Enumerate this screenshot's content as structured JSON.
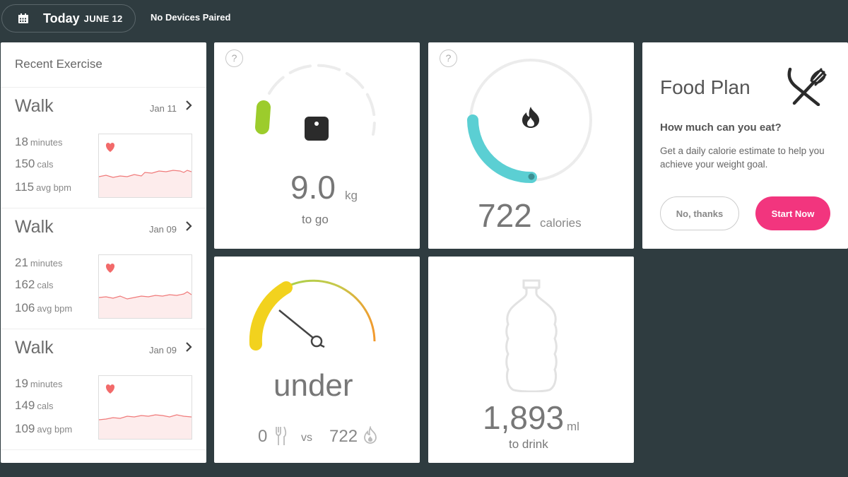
{
  "header": {
    "today": "Today",
    "date": "JUNE 12",
    "devices": "No Devices Paired"
  },
  "exercise": {
    "title": "Recent Exercise",
    "items": [
      {
        "name": "Walk",
        "date": "Jan 11",
        "minutes": "18",
        "minutes_unit": "minutes",
        "cals": "150",
        "cals_unit": "cals",
        "bpm": "115",
        "bpm_unit": "avg bpm"
      },
      {
        "name": "Walk",
        "date": "Jan 09",
        "minutes": "21",
        "minutes_unit": "minutes",
        "cals": "162",
        "cals_unit": "cals",
        "bpm": "106",
        "bpm_unit": "avg bpm"
      },
      {
        "name": "Walk",
        "date": "Jan 09",
        "minutes": "19",
        "minutes_unit": "minutes",
        "cals": "149",
        "cals_unit": "cals",
        "bpm": "109",
        "bpm_unit": "avg bpm"
      }
    ]
  },
  "weight": {
    "help": "?",
    "value": "9.0",
    "unit": "kg",
    "label": "to go"
  },
  "calories": {
    "help": "?",
    "value": "722",
    "unit": "calories"
  },
  "food_plan": {
    "title": "Food Plan",
    "question": "How much can you eat?",
    "description": "Get a daily calorie estimate to help you achieve your weight goal.",
    "no_label": "No, thanks",
    "start_label": "Start Now"
  },
  "balance": {
    "status": "under",
    "food": "0",
    "vs": "vs",
    "burned": "722"
  },
  "water": {
    "value": "1,893",
    "unit": "ml",
    "label": "to drink"
  },
  "colors": {
    "accent_pink": "#f2357e",
    "teal": "#5bcfd3",
    "lime": "#9ccc2c",
    "background": "#2f3c40",
    "heart": "#f26a6a"
  },
  "icons": [
    "calendar-icon",
    "chevron-right-icon",
    "heart-icon",
    "scale-icon",
    "flame-icon",
    "fork-knife-icon",
    "fork-icon",
    "water-bottle-icon"
  ]
}
